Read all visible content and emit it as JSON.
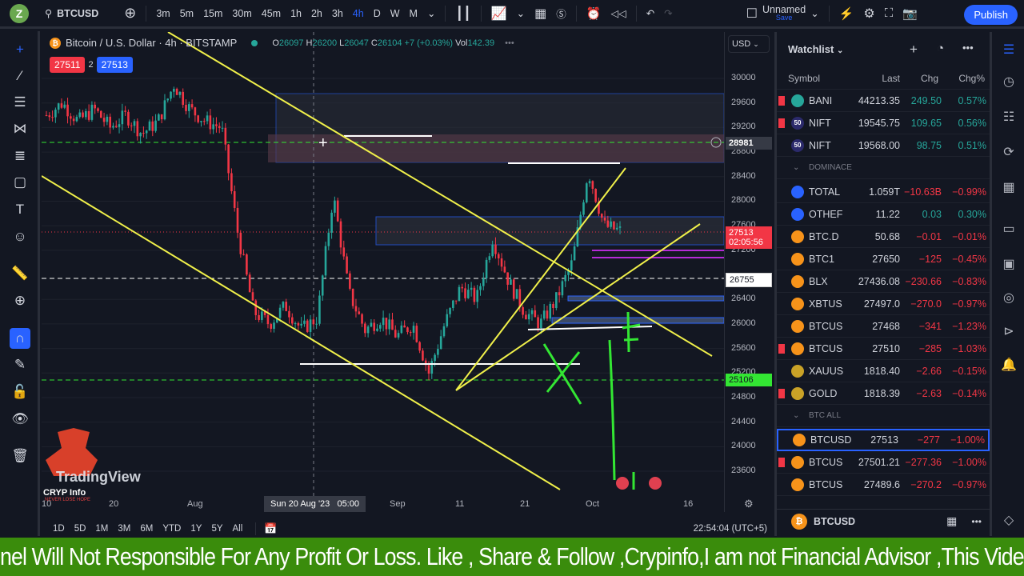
{
  "topbar": {
    "logo": "Z",
    "symbol": "BTCUSD",
    "intervals": [
      "3m",
      "5m",
      "15m",
      "30m",
      "45m",
      "1h",
      "2h",
      "3h",
      "4h",
      "D",
      "W",
      "M"
    ],
    "active_interval": "4h",
    "layout_name": "Unnamed",
    "layout_save": "Save",
    "publish": "Publish"
  },
  "legend": {
    "title": "Bitcoin / U.S. Dollar · 4h · BITSTAMP",
    "o_label": "O",
    "o": "26097",
    "h_label": "H",
    "h": "26200",
    "l_label": "L",
    "l": "26047",
    "c_label": "C",
    "c": "26104",
    "change": "+7 (+0.03%)",
    "vol_label": "Vol",
    "vol": "142.39"
  },
  "badges": {
    "sell": "27511",
    "spread": "2",
    "buy": "27513"
  },
  "price_axis": {
    "currency": "USD",
    "ticks": [
      "30000",
      "29600",
      "29200",
      "28800",
      "28400",
      "28000",
      "27600",
      "27200",
      "26400",
      "26000",
      "25600",
      "25200",
      "24800",
      "24400",
      "24000",
      "23600"
    ],
    "labels": {
      "crosshair": "28981",
      "last": "27513",
      "countdown": "02:05:56",
      "line_white": "26755",
      "line_green": "25106"
    }
  },
  "time_axis": {
    "ticks": [
      "10",
      "20",
      "Aug",
      "Sep",
      "11",
      "21",
      "Oct",
      "16"
    ],
    "crosshair": "Sun 20 Aug '23   05:00"
  },
  "range_bar": {
    "ranges": [
      "1D",
      "5D",
      "1M",
      "3M",
      "6M",
      "YTD",
      "1Y",
      "5Y",
      "All"
    ],
    "clock": "22:54:04 (UTC+5)"
  },
  "watermark": {
    "brand": "TradingView",
    "channel": "CRYP Info",
    "slogan": "NEVER LOSE HOPE"
  },
  "colors": {
    "up": "#26a69a",
    "down": "#f23645",
    "accent": "#2962ff",
    "trendline": "#f0f04a",
    "marker": "#33e633"
  },
  "chart_data": {
    "type": "candlestick",
    "ylim": [
      23400,
      30200
    ],
    "close_path": [
      29400,
      29600,
      29300,
      29500,
      29200,
      29400,
      29100,
      29300,
      29900,
      29500,
      29300,
      29200,
      27500,
      26200,
      26000,
      26300,
      25900,
      26100,
      28100,
      26500,
      25900,
      26100,
      25800,
      26000,
      25200,
      26000,
      26600,
      26400,
      27400,
      26700,
      26200,
      26000,
      26400,
      27000,
      28500,
      27600,
      27513
    ]
  },
  "watchlist": {
    "title": "Watchlist",
    "columns": [
      "Symbol",
      "Last",
      "Chg",
      "Chg%"
    ],
    "rows": [
      {
        "sym": "BANI",
        "last": "44213.35",
        "chg": "249.50",
        "pct": "0.57%",
        "dir": "up",
        "icon": "#26a69a",
        "flag": true
      },
      {
        "sym": "NIFT",
        "last": "19545.75",
        "chg": "109.65",
        "pct": "0.56%",
        "dir": "up",
        "icon": "#2b2a6b",
        "flag": true,
        "ic": "50"
      },
      {
        "sym": "NIFT",
        "last": "19568.00",
        "chg": "98.75",
        "pct": "0.51%",
        "dir": "up",
        "icon": "#2b2a6b",
        "ic": "50"
      },
      {
        "group": "DOMINACE"
      },
      {
        "sym": "TOTAL",
        "last": "1.059T",
        "chg": "−10.63B",
        "pct": "−0.99%",
        "dir": "down",
        "icon": "#2962ff"
      },
      {
        "sym": "OTHEF",
        "last": "11.22",
        "chg": "0.03",
        "pct": "0.30%",
        "dir": "up",
        "icon": "#2962ff"
      },
      {
        "sym": "BTC.D",
        "last": "50.68",
        "chg": "−0.01",
        "pct": "−0.01%",
        "dir": "down",
        "icon": "#f7931a"
      },
      {
        "sym": "BTC1",
        "last": "27650",
        "chg": "−125",
        "pct": "−0.45%",
        "dir": "down",
        "icon": "#f7931a"
      },
      {
        "sym": "BLX",
        "last": "27436.08",
        "chg": "−230.66",
        "pct": "−0.83%",
        "dir": "down",
        "icon": "#f7931a"
      },
      {
        "sym": "XBTUS",
        "last": "27497.0",
        "chg": "−270.0",
        "pct": "−0.97%",
        "dir": "down",
        "icon": "#f7931a"
      },
      {
        "sym": "BTCUS",
        "last": "27468",
        "chg": "−341",
        "pct": "−1.23%",
        "dir": "down",
        "icon": "#f7931a"
      },
      {
        "sym": "BTCUS",
        "last": "27510",
        "chg": "−285",
        "pct": "−1.03%",
        "dir": "down",
        "icon": "#f7931a",
        "flag": true
      },
      {
        "sym": "XAUUS",
        "last": "1818.40",
        "chg": "−2.66",
        "pct": "−0.15%",
        "dir": "down",
        "icon": "#c9a227"
      },
      {
        "sym": "GOLD",
        "last": "1818.39",
        "chg": "−2.63",
        "pct": "−0.14%",
        "dir": "down",
        "icon": "#c9a227",
        "flag": true
      },
      {
        "group": "BTC ALL"
      },
      {
        "sym": "BTCUSD",
        "last": "27513",
        "chg": "−277",
        "pct": "−1.00%",
        "dir": "down",
        "icon": "#f7931a",
        "selected": true
      },
      {
        "sym": "BTCUS",
        "last": "27501.21",
        "chg": "−277.36",
        "pct": "−1.00%",
        "dir": "down",
        "icon": "#f7931a",
        "flag": true
      },
      {
        "sym": "BTCUS",
        "last": "27489.6",
        "chg": "−270.2",
        "pct": "−0.97%",
        "dir": "down",
        "icon": "#f7931a"
      }
    ],
    "footer_symbol": "BTCUSD"
  },
  "ticker_text": "nel Will Not Responsible For Any Profit Or Loss. Like , Share & Follow ,Crypinfo,I am not Financial Advisor ,This Vide"
}
